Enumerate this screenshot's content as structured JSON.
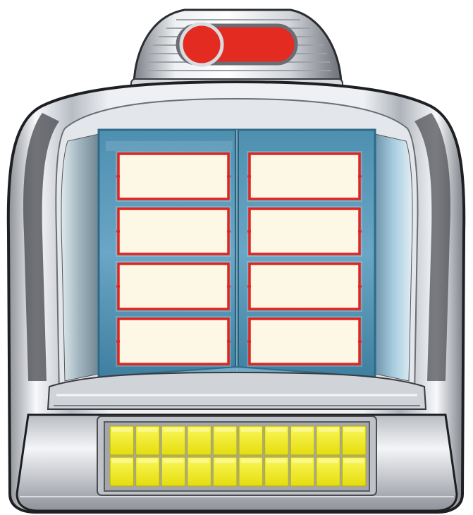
{
  "jukebox": {
    "colors": {
      "chrome_light": "#f4f5f7",
      "chrome_mid": "#c9ccd2",
      "chrome_dark": "#5c5f66",
      "chrome_shadow": "#2a2b2f",
      "glass_blue": "#5f9fc0",
      "glass_blue_light": "#9ec8dd",
      "glass_frame": "#3f7f9f",
      "card_fill": "#fdf8e6",
      "card_border": "#e0241f",
      "dome_red": "#e32b22",
      "key_yellow": "#f2ee1a",
      "key_border": "#b7b21a",
      "key_panel": "#9a9a9a"
    },
    "selector_cards": {
      "left": [
        "",
        "",
        "",
        ""
      ],
      "right": [
        "",
        "",
        "",
        ""
      ]
    },
    "keypad": {
      "rows": 2,
      "columns": 10
    }
  }
}
